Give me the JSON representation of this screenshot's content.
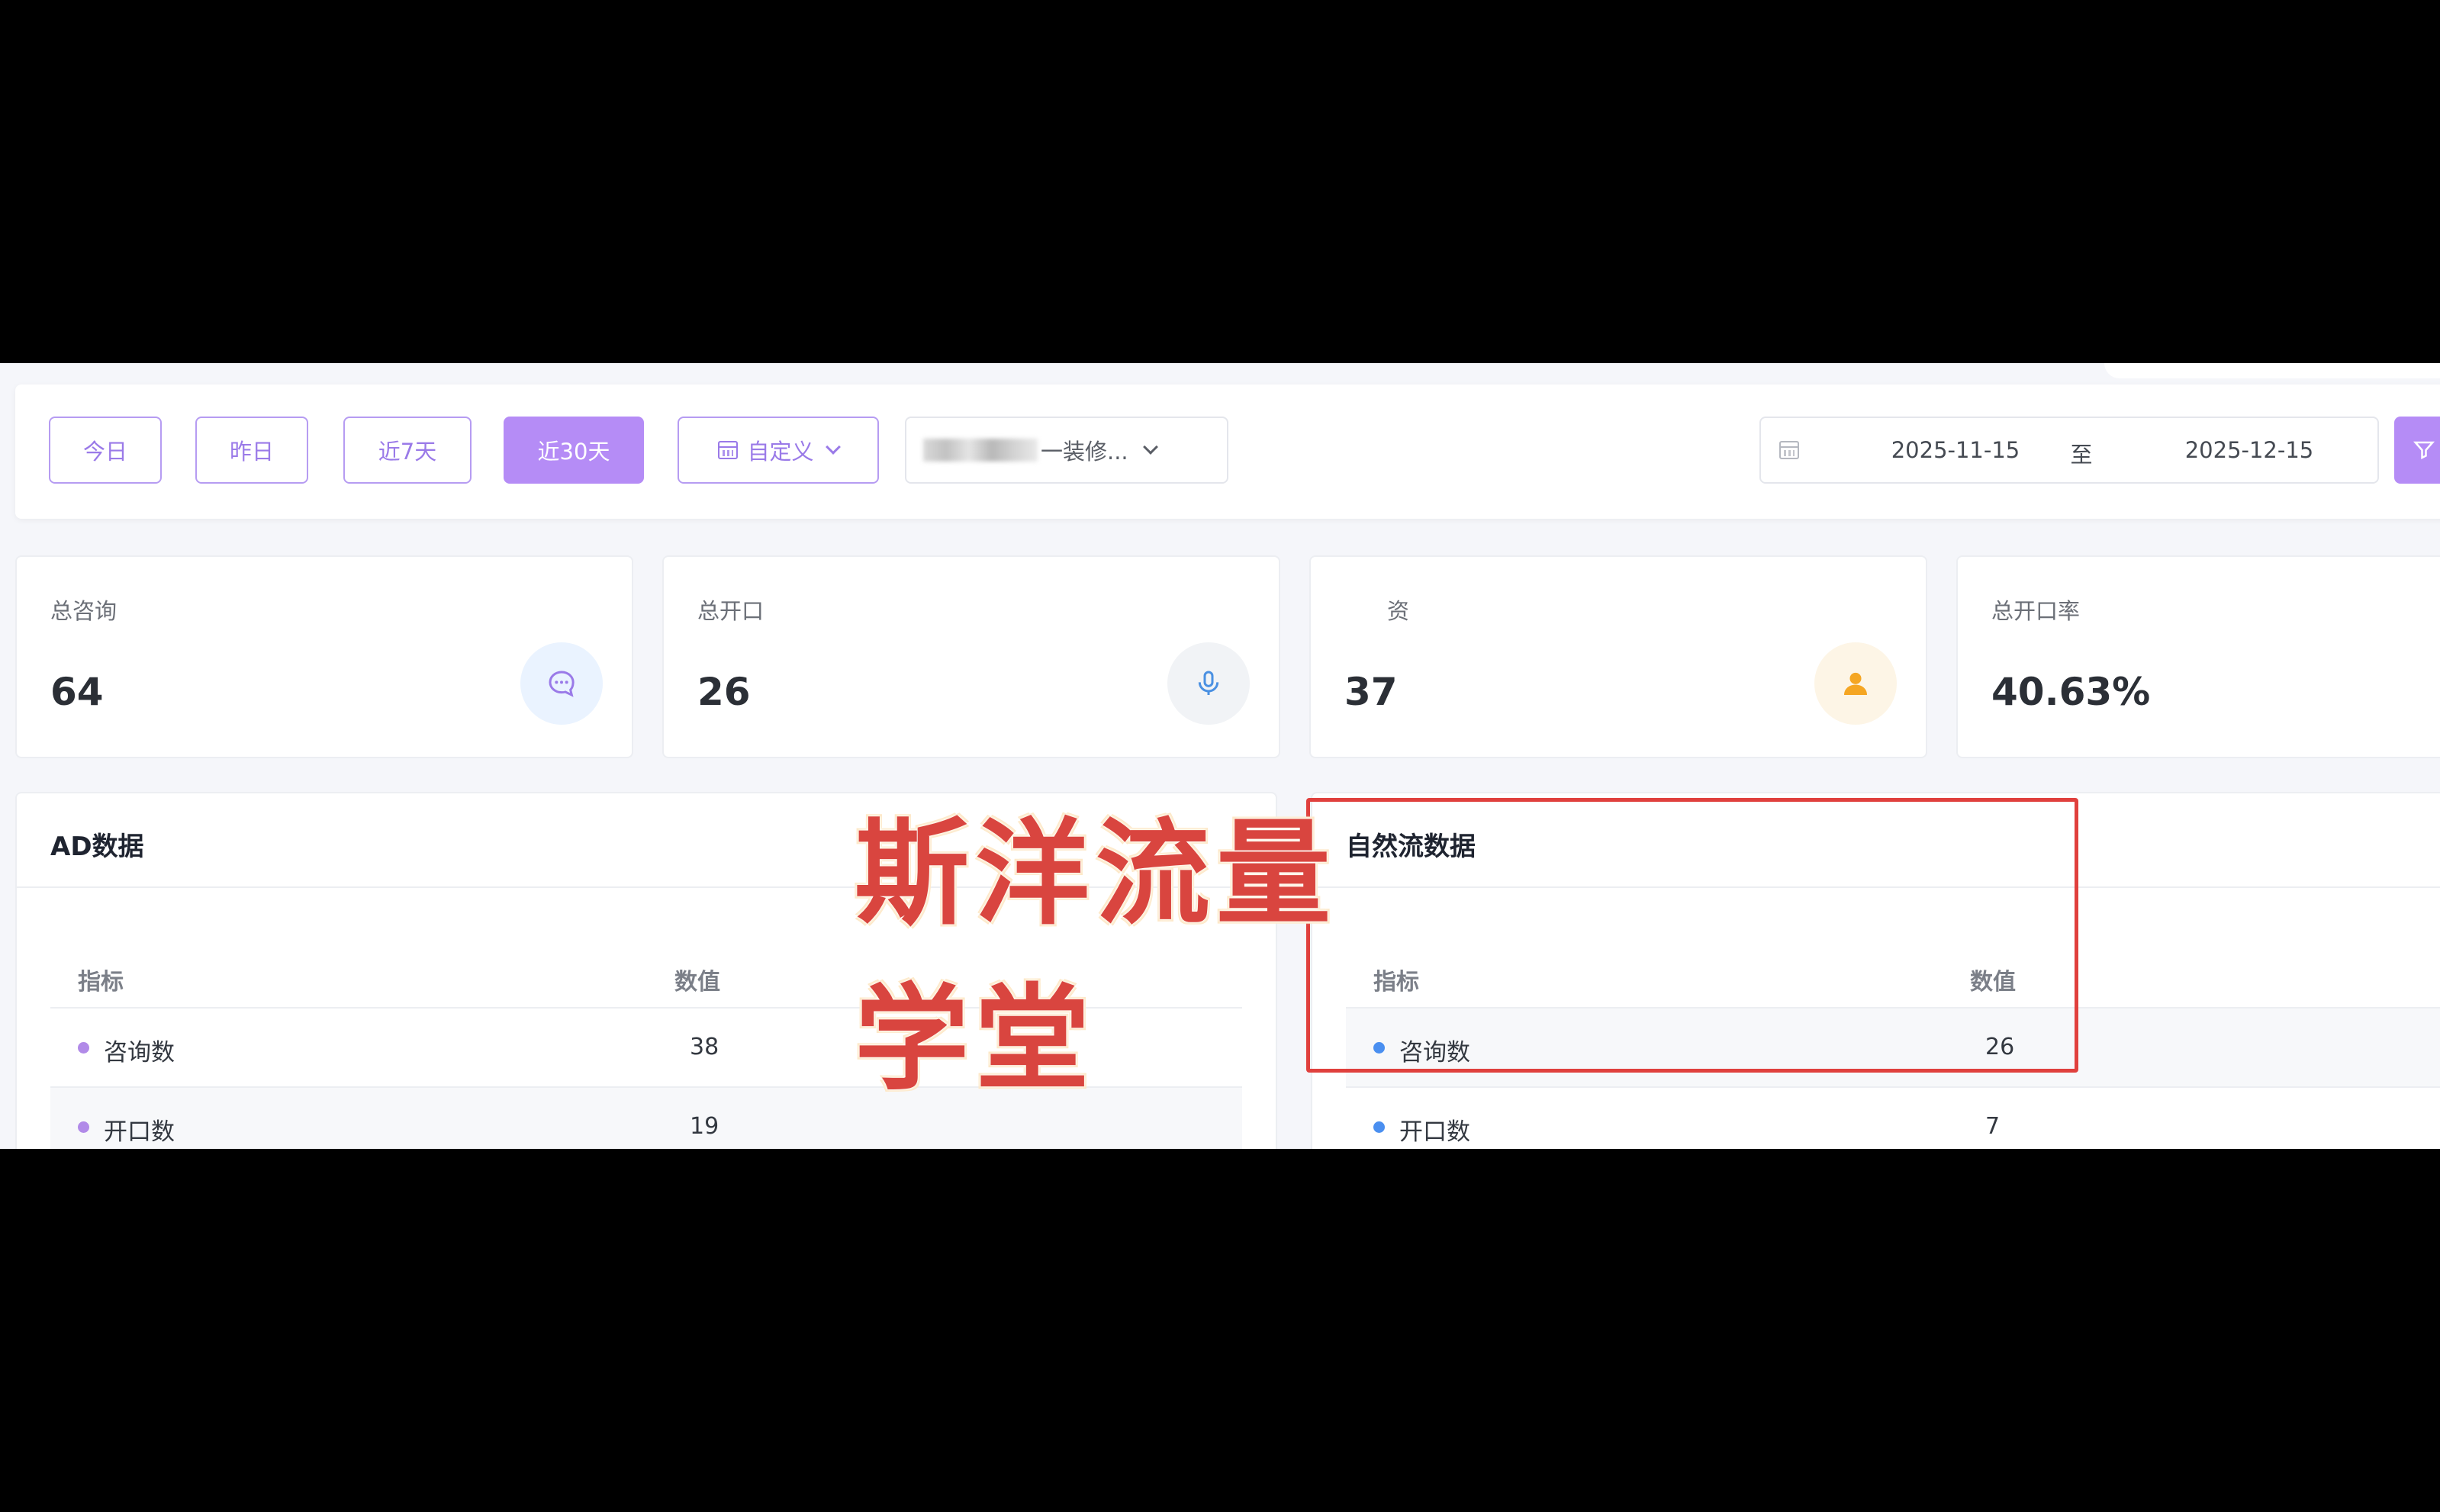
{
  "filters": {
    "quick": [
      "今日",
      "昨日",
      "近7天",
      "近30天"
    ],
    "active_quick": "近30天",
    "custom_label": "自定义",
    "store_dropdown_label": "一装修...",
    "date_start": "2025-11-15",
    "date_separator": "至",
    "date_end": "2025-12-15"
  },
  "stats": [
    {
      "label": "总咨询",
      "value": "64",
      "icon": "chat-icon",
      "icon_color": "#9a7ae8",
      "icon_bg": "#eaf3ff"
    },
    {
      "label": "总开口",
      "value": "26",
      "icon": "microphone-icon",
      "icon_color": "#4a90e2",
      "icon_bg": "#f1f3f6"
    },
    {
      "label": "资",
      "value": "37",
      "icon": "user-icon",
      "icon_color": "#f5a623",
      "icon_bg": "#fdf5e6"
    },
    {
      "label": "总开口率",
      "value": "40.63%"
    }
  ],
  "ad_panel": {
    "title": "AD数据",
    "columns": [
      "指标",
      "数值"
    ],
    "dot_color": "#b18ae8",
    "rows": [
      {
        "label": "咨询数",
        "value": "38"
      },
      {
        "label": "开口数",
        "value": "19"
      }
    ]
  },
  "natural_panel": {
    "title": "自然流数据",
    "columns": [
      "指标",
      "数值"
    ],
    "dot_color": "#4a8ff0",
    "rows": [
      {
        "label": "咨询数",
        "value": "26"
      },
      {
        "label": "开口数",
        "value": "7"
      }
    ]
  },
  "watermark": "斯洋流量学堂",
  "colors": {
    "accent": "#b58cf6",
    "highlight": "#e0403d"
  }
}
